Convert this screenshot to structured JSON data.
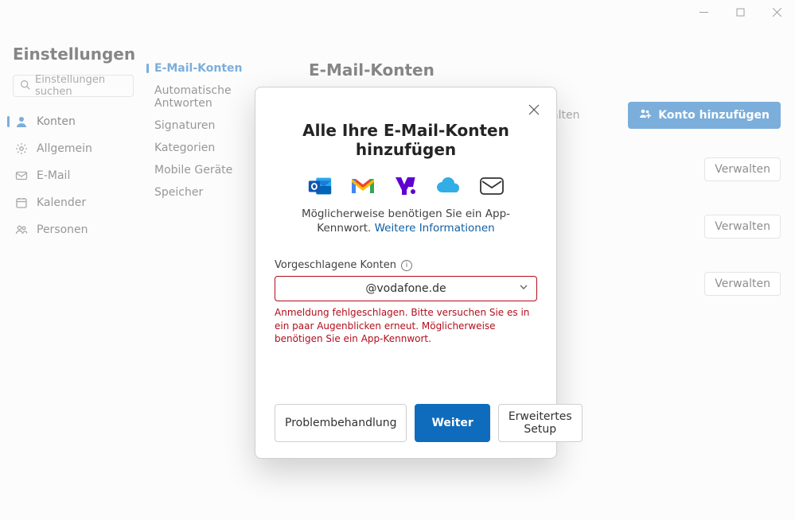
{
  "window": {
    "minimize_name": "minimize",
    "maximize_name": "maximize",
    "close_name": "close"
  },
  "sidebar": {
    "title": "Einstellungen",
    "search_placeholder": "Einstellungen suchen",
    "items": [
      {
        "label": "Konten",
        "icon": "person-icon",
        "active": true
      },
      {
        "label": "Allgemein",
        "icon": "gear-icon",
        "active": false
      },
      {
        "label": "E-Mail",
        "icon": "mail-icon",
        "active": false
      },
      {
        "label": "Kalender",
        "icon": "calendar-icon",
        "active": false
      },
      {
        "label": "Personen",
        "icon": "people-icon",
        "active": false
      }
    ]
  },
  "subnav": {
    "items": [
      {
        "label": "E-Mail-Konten",
        "active": true
      },
      {
        "label": "Automatische Antworten",
        "active": false
      },
      {
        "label": "Signaturen",
        "active": false
      },
      {
        "label": "Kategorien",
        "active": false
      },
      {
        "label": "Mobile Geräte",
        "active": false
      },
      {
        "label": "Speicher",
        "active": false
      }
    ]
  },
  "main": {
    "heading": "E-Mail-Konten",
    "partial_text": "alten",
    "add_button": "Konto hinzufügen",
    "manage_button": "Verwalten",
    "account_rows": 3
  },
  "dialog": {
    "title": "Alle Ihre E-Mail-Konten hinzufügen",
    "subtitle_prefix": "Möglicherweise benötigen Sie ein App-Kennwort.  ",
    "subtitle_link": "Weitere Informationen",
    "suggested_label": "Vorgeschlagene Konten",
    "suggested_value": "@vodafone.de",
    "error_text": "Anmeldung fehlgeschlagen. Bitte versuchen Sie es in ein paar Augenblicken erneut. Möglicherweise benötigen Sie ein App-Kennwort.",
    "buttons": {
      "troubleshoot": "Problembehandlung",
      "continue": "Weiter",
      "advanced": "Erweitertes Setup"
    },
    "brand_icons": [
      "outlook-icon",
      "gmail-icon",
      "yahoo-icon",
      "icloud-icon",
      "generic-mail-icon"
    ]
  }
}
